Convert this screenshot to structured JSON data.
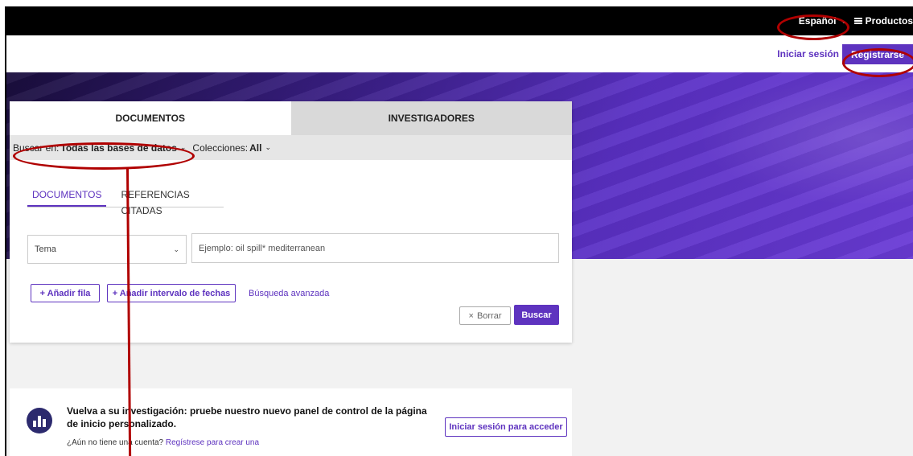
{
  "topbar": {
    "language": "Español",
    "products": "Productos"
  },
  "auth": {
    "signin": "Iniciar sesión",
    "register": "Registrarse"
  },
  "search_card": {
    "tabs": [
      "DOCUMENTOS",
      "INVESTIGADORES"
    ],
    "scope": {
      "label": "Buscar en:",
      "value": "Todas las bases de datos",
      "collections_label": "Colecciones:",
      "collections_value": "All"
    },
    "subtabs": [
      "DOCUMENTOS",
      "REFERENCIAS CITADAS"
    ],
    "field_select": "Tema",
    "query_placeholder": "Ejemplo: oil spill* mediterranean",
    "add_row": "+ Añadir fila",
    "add_dates": "+ Añadir intervalo de fechas",
    "advanced": "Búsqueda avanzada",
    "clear": "Borrar",
    "search": "Buscar"
  },
  "promo": {
    "title": "Vuelva a su investigación: pruebe nuestro nuevo panel de control de la página de inicio personalizado.",
    "no_account": "¿Aún no tiene una cuenta?",
    "register_link": "Regístrese para crear una",
    "button": "Iniciar sesión para acceder"
  },
  "colors": {
    "accent": "#5e33bf",
    "annotation": "#b00000"
  }
}
